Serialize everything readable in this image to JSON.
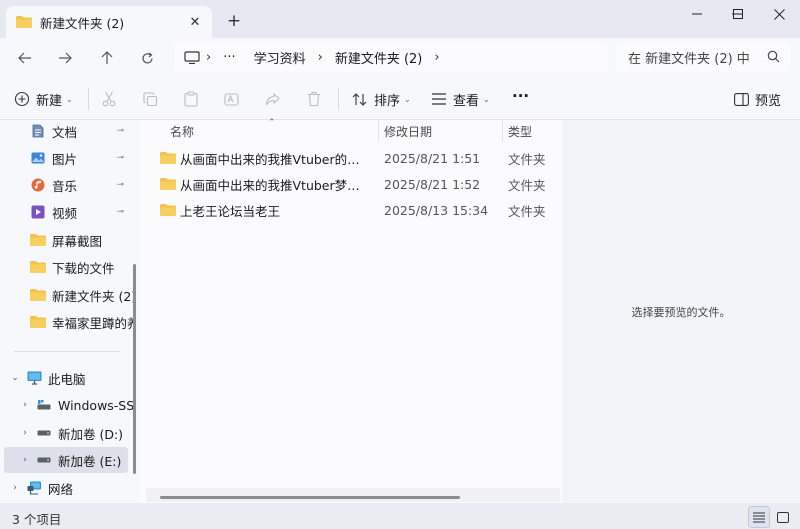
{
  "window": {
    "tab_title": "新建文件夹 (2)",
    "tab_close": "✕",
    "new_tab": "+",
    "minimize": "—",
    "maximize": "☐",
    "close": "✕"
  },
  "navigation": {
    "breadcrumb": [
      "学习资料",
      "新建文件夹 (2)"
    ],
    "ellipsis": "···",
    "separator": "›",
    "search_placeholder": "在 新建文件夹 (2) 中"
  },
  "toolbar": {
    "new_label": "新建",
    "sort_label": "排序",
    "view_label": "查看",
    "more_label": "···",
    "preview_label": "预览",
    "caret": "⌄"
  },
  "sidebar": {
    "quick_access": [
      {
        "label": "文档",
        "icon": "document-icon",
        "pinned": true
      },
      {
        "label": "图片",
        "icon": "picture-icon",
        "pinned": true
      },
      {
        "label": "音乐",
        "icon": "music-icon",
        "pinned": true
      },
      {
        "label": "视频",
        "icon": "video-icon",
        "pinned": true
      },
      {
        "label": "屏幕截图",
        "icon": "folder-icon",
        "pinned": false
      },
      {
        "label": "下载的文件",
        "icon": "folder-icon",
        "pinned": false
      },
      {
        "label": "新建文件夹 (2)",
        "icon": "folder-icon",
        "pinned": false
      },
      {
        "label": "幸福家里蹲的养",
        "icon": "folder-icon",
        "pinned": false
      }
    ],
    "this_pc": "此电脑",
    "drives": [
      {
        "label": "Windows-SSD",
        "icon": "drive-icon"
      },
      {
        "label": "新加卷 (D:)",
        "icon": "drive-icon"
      },
      {
        "label": "新加卷 (E:)",
        "icon": "drive-icon",
        "selected": true
      }
    ],
    "network": "网络",
    "pin_glyph": "📌"
  },
  "file_list": {
    "columns": {
      "name": "名称",
      "date": "修改日期",
      "type": "类型"
    },
    "rows": [
      {
        "name": "从画面中出来的我推Vtuber的同居生活",
        "date": "2025/8/21 1:51",
        "type": "文件夹"
      },
      {
        "name": "从画面中出来的我推Vtuber梦魔可爱",
        "date": "2025/8/21 1:52",
        "type": "文件夹"
      },
      {
        "name": "上老王论坛当老王",
        "date": "2025/8/13 15:34",
        "type": "文件夹"
      }
    ]
  },
  "preview_pane": {
    "empty_text": "选择要预览的文件。"
  },
  "status": {
    "item_count": "3 个项目"
  },
  "colors": {
    "folder": "#f2c34b",
    "folder_dark": "#e0a526",
    "accent": "#2b6fd1"
  }
}
